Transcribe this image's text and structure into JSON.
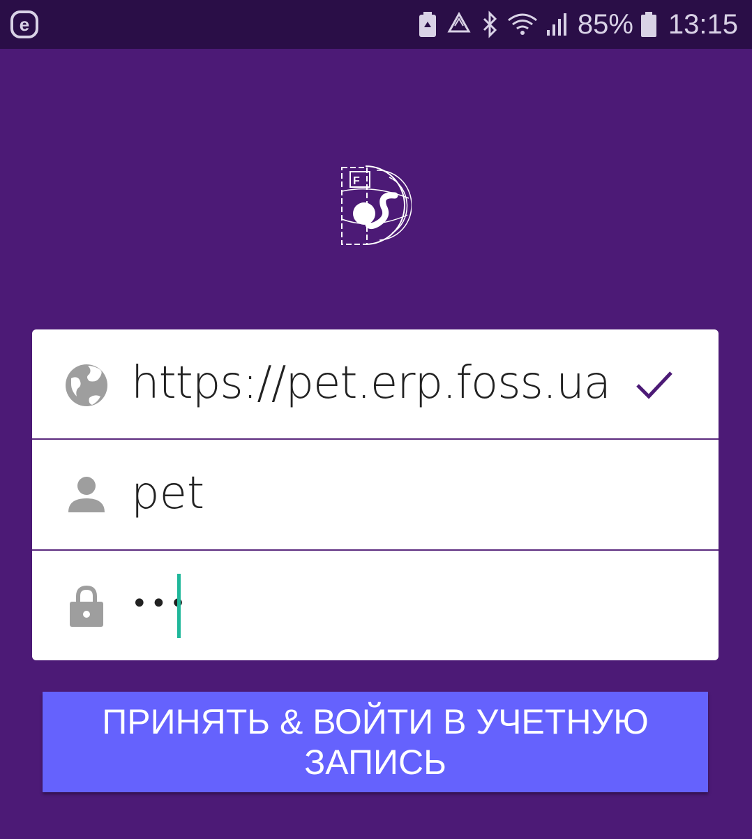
{
  "status_bar": {
    "app_icon": "e-circle-icon",
    "icons": [
      "battery-saver-icon",
      "recycle-icon",
      "bluetooth-icon",
      "wifi-icon",
      "signal-icon",
      "battery-icon"
    ],
    "battery_percent": "85%",
    "time": "13:15"
  },
  "logo": {
    "name": "foss-logo",
    "text": "FOSS"
  },
  "form": {
    "server": {
      "icon": "globe-icon",
      "value": "https://pet.erp.foss.ua",
      "status_icon": "check-icon"
    },
    "username": {
      "icon": "person-icon",
      "value": "pet"
    },
    "password": {
      "icon": "lock-icon",
      "masked_value": "•••"
    }
  },
  "login_button": {
    "label": "ПРИНЯТЬ & ВОЙТИ В УЧЕТНУЮ ЗАПИСЬ"
  },
  "colors": {
    "background": "#4c1a76",
    "status_bar": "#2a0e47",
    "button": "#6562fd",
    "cursor": "#1fb79a",
    "check": "#4c1a76",
    "icon_gray": "#9e9e9e"
  }
}
